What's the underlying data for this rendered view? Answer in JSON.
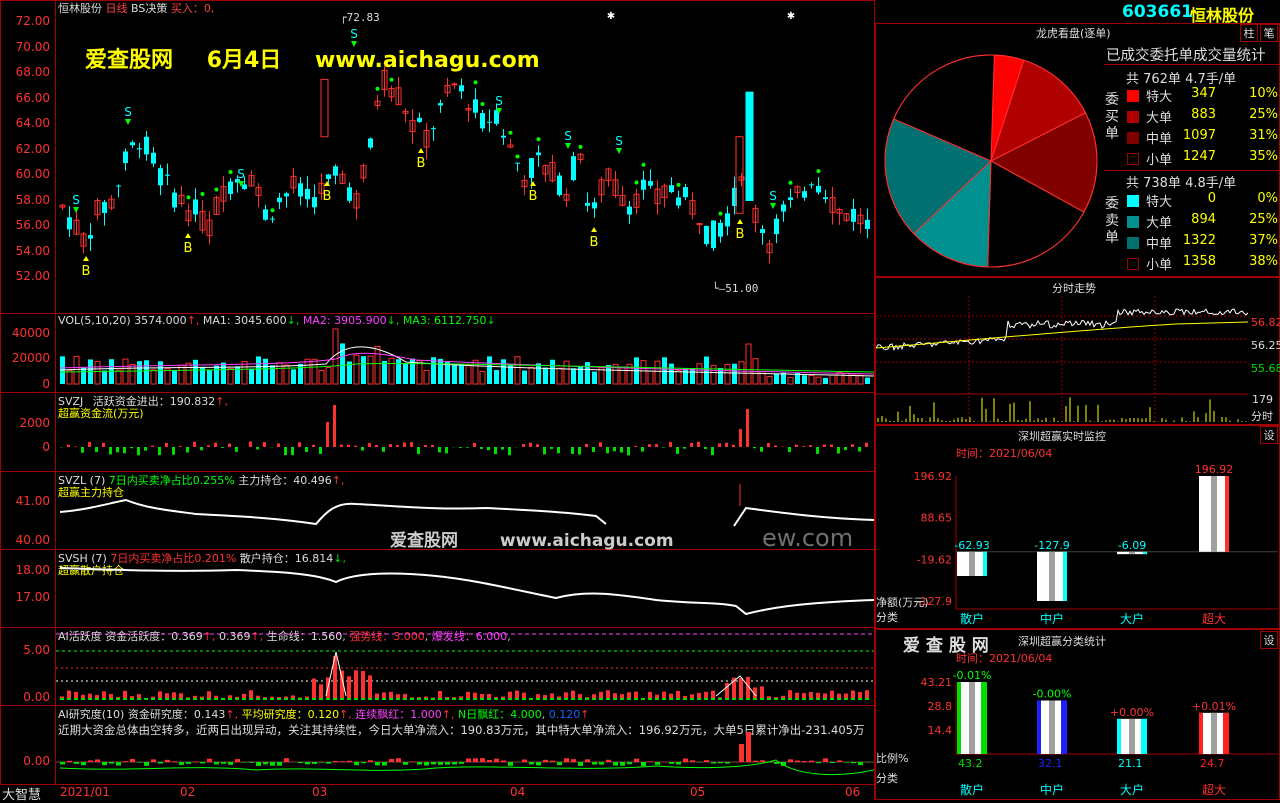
{
  "header": {
    "stock_name": "恒林股份",
    "period": "日线",
    "indicator": "BS决策",
    "buy_label": "买入：0,"
  },
  "watermark_top": {
    "site": "爱查股网",
    "date": "6月4日",
    "url": "www.aichagu.com"
  },
  "watermark_mid": {
    "site": "爱查股网",
    "url": "www.aichagu.com",
    "faded": "ew.com"
  },
  "price_chart": {
    "y_ticks": [
      "72.00",
      "70.00",
      "68.00",
      "66.00",
      "64.00",
      "62.00",
      "60.00",
      "58.00",
      "56.00",
      "54.00",
      "52.00"
    ],
    "high_label": "72.83",
    "low_label": "51.00",
    "chart_data": {
      "type": "candlestick",
      "ylim": [
        51,
        73
      ],
      "high": 72.83,
      "low": 51.0,
      "signals_buy_label": "B",
      "signals_sell_label": "S"
    }
  },
  "vol_panel": {
    "title": "VOL(5,10,20)",
    "vol": "3574.000",
    "ma1_label": "MA1:",
    "ma1": "3045.600",
    "ma2_label": "MA2:",
    "ma2": "3905.900",
    "ma3_label": "MA3:",
    "ma3": "6112.750",
    "y_ticks": [
      "40000",
      "20000",
      "0"
    ]
  },
  "svzj_panel": {
    "title": "SVZJ",
    "label": "活跃资金进出：",
    "value": "190.832",
    "subtitle": "超赢资金流(万元)",
    "y_ticks": [
      "2000",
      "0"
    ]
  },
  "svzl_panel": {
    "title": "SVZL (7)",
    "ratio_label": "7日内买卖净占比0.255%",
    "hold_label": "主力持仓：",
    "hold_value": "40.496",
    "subtitle": "超赢主力持仓",
    "y_ticks": [
      "41.00",
      "40.00"
    ]
  },
  "svsh_panel": {
    "title": "SVSH (7)",
    "ratio_label": "7日内买卖净占比0.201%",
    "hold_label": "散户持仓：",
    "hold_value": "16.814",
    "subtitle": "超赢散户持仓",
    "y_ticks": [
      "18.00",
      "17.00"
    ]
  },
  "ai_active_panel": {
    "title": "AI活跃度",
    "label": "资金活跃度：",
    "value": "0.369",
    "value2": "0.369",
    "life_label": "生命线：",
    "life_value": "1.560",
    "strong_label": "强势线：",
    "strong_value": "3.000",
    "burst_label": "爆发线：",
    "burst_value": "6.000",
    "y_ticks": [
      "5.00",
      "0.00"
    ]
  },
  "ai_research_panel": {
    "title": "AI研究度(10)",
    "label": "资金研究度：",
    "value": "0.143",
    "avg_label": "平均研究度：",
    "avg_value": "0.120",
    "streak_label": "连续飘红：",
    "streak_value": "1.000",
    "n_label": "N日飘红：",
    "n_value": "4.000",
    "extra_value": "0.120",
    "comment": "近期大资金总体由空转多，近两日出现异动，关注其持续性，今日大单净流入：190.83万元，其中特大单净流入：196.92万元，大单5日累计净出-231.405万",
    "y_ticks": [
      "0.00"
    ]
  },
  "x_axis": {
    "labels": [
      "2021/01",
      "02",
      "03",
      "04",
      "05",
      "06"
    ]
  },
  "bottom_left": "大智慧",
  "right": {
    "code": "603661",
    "name": "恒林股份",
    "btn_zhu": "柱",
    "btn_bi": "笔",
    "dragon_title": "龙虎看盘(逐单)",
    "stats_title": "已成交委托单成交量统计",
    "buy_side": {
      "label": "委买单",
      "total": "共 762单 4.7手/单",
      "rows": [
        {
          "name": "特大",
          "count": "347",
          "pct": "10%",
          "color": "#ff0000"
        },
        {
          "name": "大单",
          "count": "883",
          "pct": "25%",
          "color": "#b00000"
        },
        {
          "name": "中单",
          "count": "1097",
          "pct": "31%",
          "color": "#800000"
        },
        {
          "name": "小单",
          "count": "1247",
          "pct": "35%",
          "color": "#000000"
        }
      ]
    },
    "sell_side": {
      "label": "委卖单",
      "total": "共 738单 4.8手/单",
      "rows": [
        {
          "name": "特大",
          "count": "0",
          "pct": "0%",
          "color": "#00ffff"
        },
        {
          "name": "大单",
          "count": "894",
          "pct": "25%",
          "color": "#009090"
        },
        {
          "name": "中单",
          "count": "1322",
          "pct": "37%",
          "color": "#007070"
        },
        {
          "name": "小单",
          "count": "1358",
          "pct": "38%",
          "color": "#000000"
        }
      ]
    },
    "intraday_title": "分时走势",
    "intraday_ticks": [
      "56.82",
      "56.25",
      "55.68"
    ],
    "intraday_vol_tick": "179",
    "intraday_vol_label": "分时",
    "monitor_title": "深圳超赢实时监控",
    "monitor_time": "时间：2021/06/04",
    "monitor_btn": "设",
    "monitor_yticks": [
      "196.92",
      "88.65",
      "-19.62",
      "-127.9"
    ],
    "monitor_ylabel": "净额(万元)",
    "monitor_xlabel": "分类",
    "monitor_chart": {
      "type": "bar",
      "categories": [
        "散户",
        "中户",
        "大户",
        "超大"
      ],
      "values": [
        -62.93,
        -127.9,
        -6.09,
        196.92
      ],
      "labels": [
        "-62.93",
        "-127.9",
        "-6.09",
        "196.92"
      ],
      "ylim": [
        -127.9,
        196.92
      ]
    },
    "brand": "爱 查 股 网",
    "class_title": "深圳超赢分类统计",
    "class_btn": "设",
    "class_time": "时间：2021/06/04",
    "class_yticks": [
      "43.21",
      "28.8",
      "14.4"
    ],
    "class_ylabel": "比例%",
    "class_xlabel": "分类",
    "class_chart": {
      "type": "bar",
      "categories": [
        "散户",
        "中户",
        "大户",
        "超大"
      ],
      "values": [
        43.2,
        32.1,
        21.1,
        24.7
      ],
      "value_labels": [
        "43.2",
        "32.1",
        "21.1",
        "24.7"
      ],
      "change_labels": [
        "-0.01%",
        "-0.00%",
        "+0.00%",
        "+0.01%"
      ],
      "colors": [
        "#00e000",
        "#2020ff",
        "#00ffff",
        "#ff2020"
      ],
      "ylim": [
        0,
        43.21
      ]
    }
  }
}
